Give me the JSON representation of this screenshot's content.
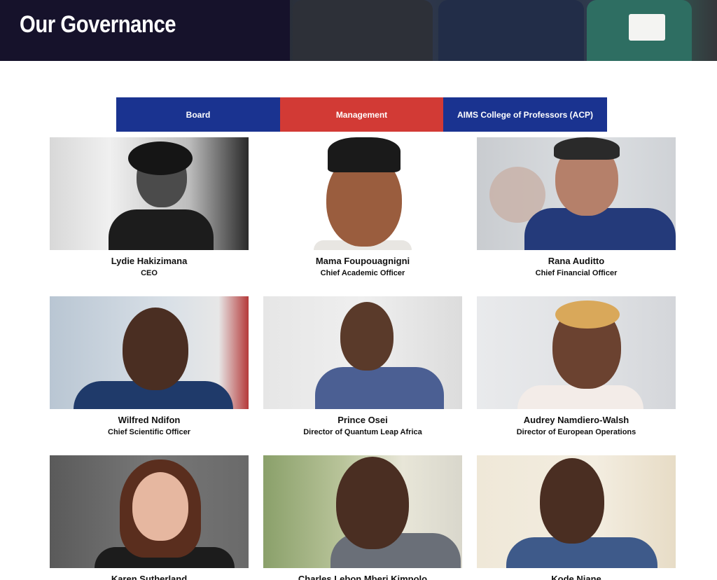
{
  "header": {
    "title": "Our Governance"
  },
  "tabs": [
    {
      "label": "Board"
    },
    {
      "label": "Management"
    },
    {
      "label": "AIMS College of Professors (ACP)"
    }
  ],
  "people": [
    {
      "name": "Lydie Hakizimana",
      "role": "CEO"
    },
    {
      "name": "Mama Foupouagnigni",
      "role": "Chief Academic Officer"
    },
    {
      "name": "Rana Auditto",
      "role": "Chief Financial Officer"
    },
    {
      "name": "Wilfred Ndifon",
      "role": "Chief Scientific Officer"
    },
    {
      "name": "Prince Osei",
      "role": "Director of Quantum Leap Africa"
    },
    {
      "name": "Audrey Namdiero-Walsh",
      "role": "Director of European Operations"
    },
    {
      "name": "Karen Sutherland",
      "role": ""
    },
    {
      "name": "Charles Lebon Mberi Kimpolo",
      "role": ""
    },
    {
      "name": "Kode Niane",
      "role": ""
    }
  ],
  "colors": {
    "header_bg": "#16122b",
    "tab_blue": "#1a3390",
    "tab_red": "#d23a35"
  }
}
